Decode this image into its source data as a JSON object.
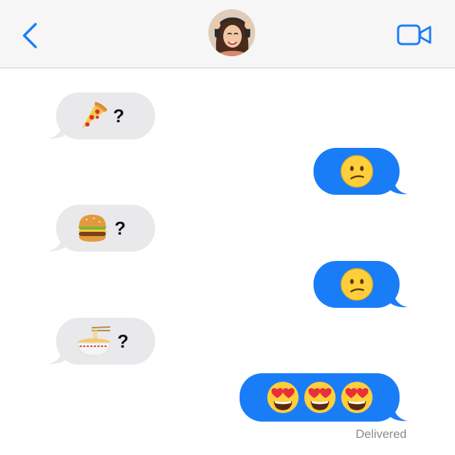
{
  "header": {
    "back_icon": "chevron-left-icon",
    "contact_avatar": "contact-avatar-photo",
    "video_icon": "video-camera-icon",
    "accent_color": "#1a7df8"
  },
  "thread": {
    "incoming_color": "#e9e9eb",
    "outgoing_color": "#1a7df8",
    "messages": [
      {
        "direction": "incoming",
        "emoji": "pizza",
        "text": "?"
      },
      {
        "direction": "outgoing",
        "emoji": "confused-face"
      },
      {
        "direction": "incoming",
        "emoji": "hamburger",
        "text": "?"
      },
      {
        "direction": "outgoing",
        "emoji": "confused-face"
      },
      {
        "direction": "incoming",
        "emoji": "ramen-bowl",
        "text": "?"
      },
      {
        "direction": "outgoing",
        "emoji": [
          "heart-eyes-face",
          "heart-eyes-face",
          "heart-eyes-face"
        ]
      }
    ],
    "status": "Delivered"
  }
}
